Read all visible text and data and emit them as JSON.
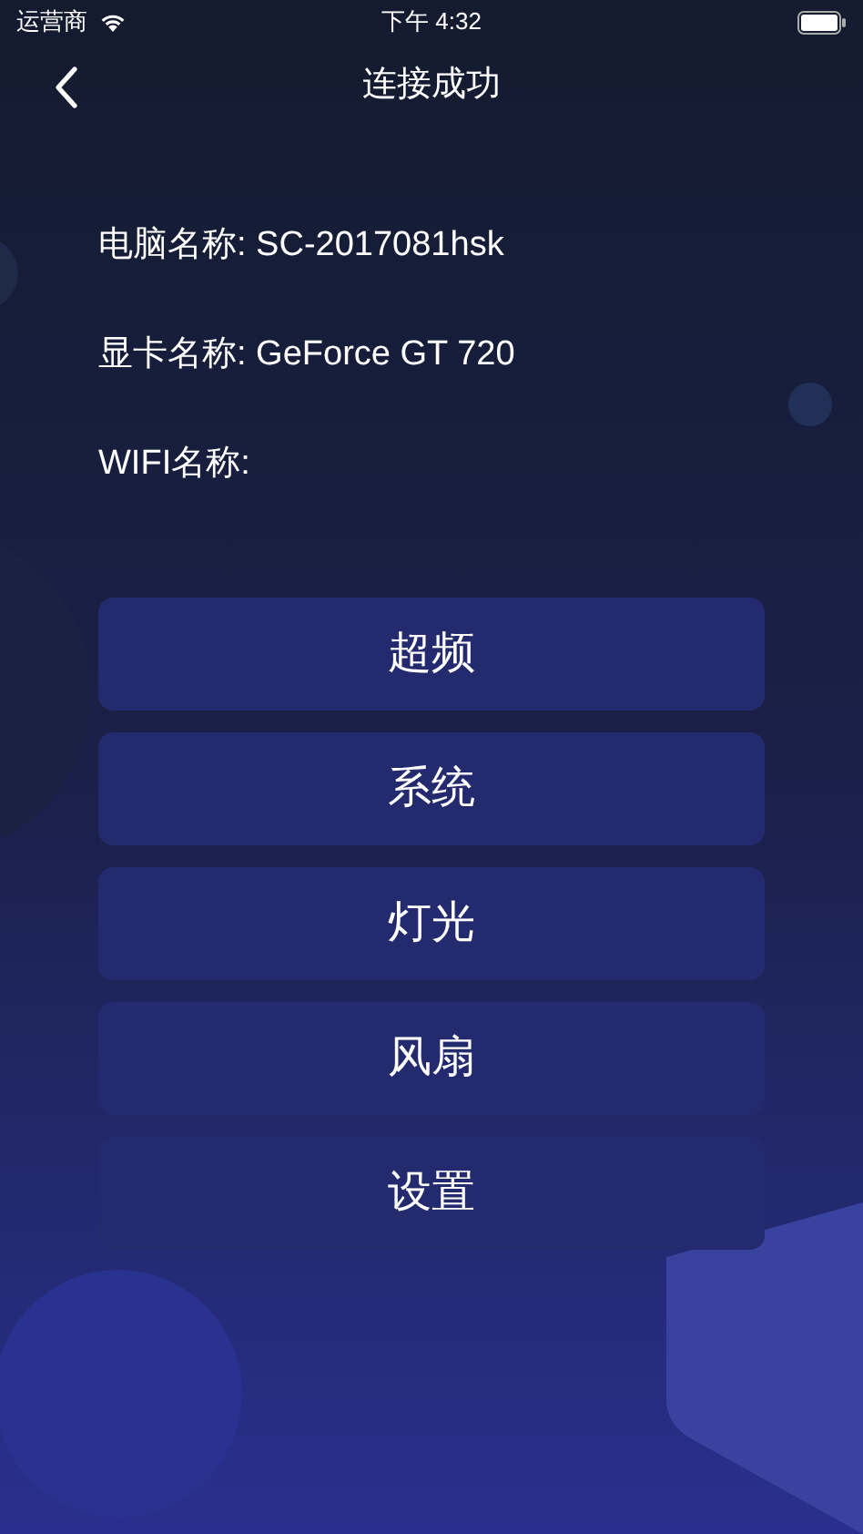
{
  "status_bar": {
    "carrier": "运营商",
    "time": "下午 4:32"
  },
  "nav": {
    "title": "连接成功"
  },
  "info": [
    "电脑名称: SC-2017081hsk",
    "显卡名称: GeForce GT 720",
    "WIFI名称:"
  ],
  "buttons": [
    "超频",
    "系统",
    "灯光",
    "风扇",
    "设置"
  ]
}
